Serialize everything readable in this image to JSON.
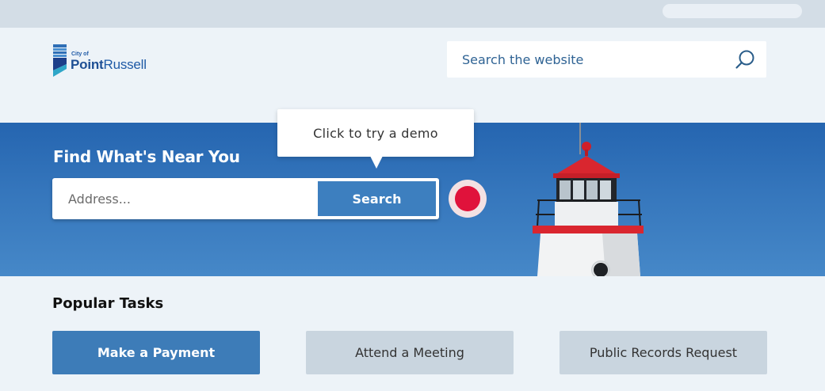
{
  "header": {
    "logo_cityof": "City of",
    "logo_name_bold": "Point",
    "logo_name_rest": "Russell",
    "search_placeholder": "Search the website"
  },
  "hero": {
    "title": "Find What's Near You",
    "address_placeholder": "Address...",
    "search_label": "Search",
    "tooltip": "Click to try a demo"
  },
  "tasks": {
    "title": "Popular Tasks",
    "items": [
      {
        "label": "Make a Payment"
      },
      {
        "label": "Attend a Meeting"
      },
      {
        "label": "Public Records Request"
      }
    ]
  },
  "colors": {
    "brand_blue": "#1f5aa6",
    "accent_red": "#e0123b",
    "primary_button": "#3d7cb8"
  }
}
